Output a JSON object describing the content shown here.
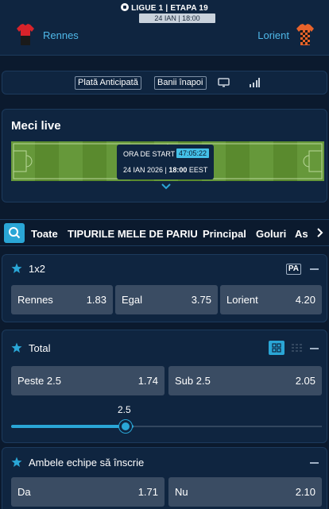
{
  "match": {
    "league": "LIGUE 1  |  ETAPA  19",
    "date_time": "24 IAN | 18:00",
    "home_team": "Rennes",
    "away_team": "Lorient",
    "home_shirt_color": "#d8232a",
    "away_shirt_color": "#e8632b"
  },
  "actions": {
    "early_payout": "Plată Anticipată",
    "money_back": "Banii înapoi",
    "tv_icon": "tv-icon",
    "stats_icon": "signal-bars-icon"
  },
  "live": {
    "title": "Meci live",
    "start_label": "ORA DE START",
    "countdown": "47:05:22",
    "start_date": "24 IAN 2026 | ",
    "start_time": "18:00",
    "timezone": " EEST"
  },
  "tabs": {
    "items": [
      "Toate",
      "TIPURILE MELE DE PARIU",
      "Principal",
      "Goluri",
      "As"
    ],
    "active": "Toate"
  },
  "markets": {
    "m1x2": {
      "title": "1x2",
      "tag": "PA",
      "options": [
        {
          "label": "Rennes",
          "odds": "1.83"
        },
        {
          "label": "Egal",
          "odds": "3.75"
        },
        {
          "label": "Lorient",
          "odds": "4.20"
        }
      ]
    },
    "total": {
      "title": "Total",
      "options": [
        {
          "label": "Peste 2.5",
          "odds": "1.74"
        },
        {
          "label": "Sub 2.5",
          "odds": "2.05"
        }
      ],
      "slider_value": "2.5"
    },
    "btts": {
      "title": "Ambele echipe să înscrie",
      "options": [
        {
          "label": "Da",
          "odds": "1.71"
        },
        {
          "label": "Nu",
          "odds": "2.10"
        }
      ]
    }
  },
  "colors": {
    "accent": "#2aa6d6",
    "background": "#0b1a2e",
    "card": "#0f2540",
    "odds_button": "#3a4c63"
  }
}
